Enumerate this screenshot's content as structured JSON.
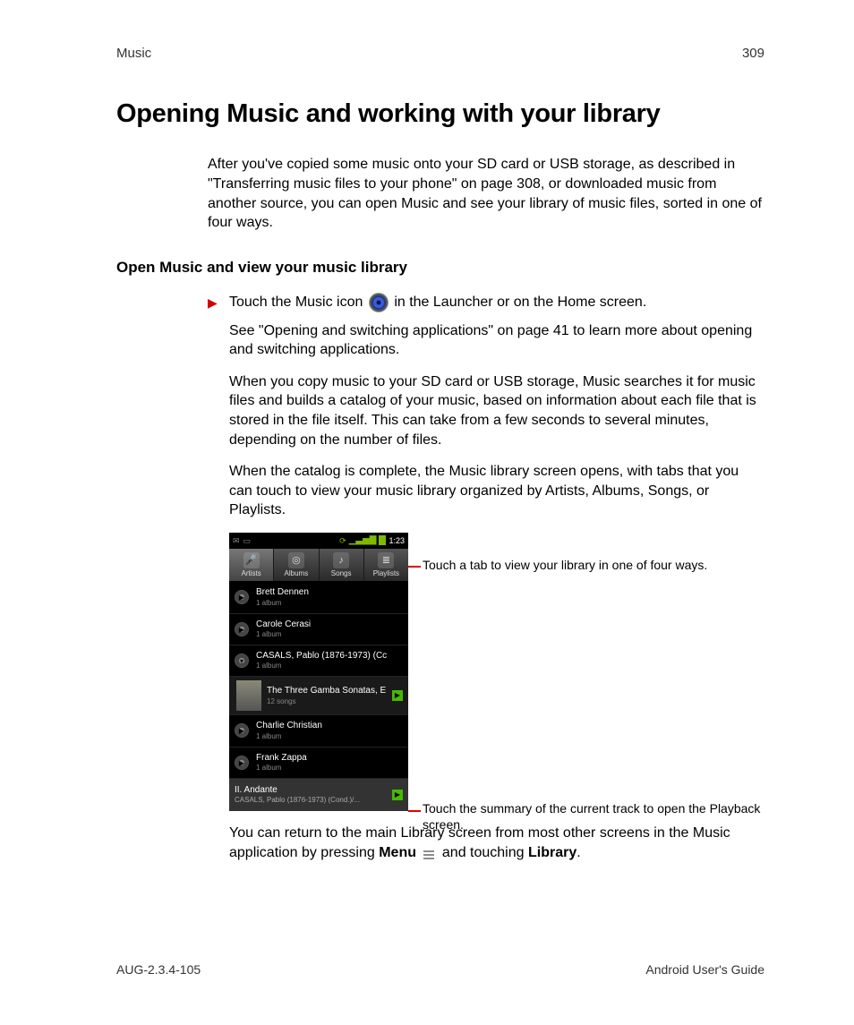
{
  "header": {
    "section": "Music",
    "page_number": "309"
  },
  "title": "Opening Music and working with your library",
  "intro": "After you've copied some music onto your SD card or USB storage, as described in \"Transferring music files to your phone\" on page 308, or downloaded music from another source, you can open Music and see your library of music files, sorted in one of four ways.",
  "subheading": "Open Music and view your music library",
  "step": {
    "pre": "Touch the Music icon ",
    "post": " in the Launcher or on the Home screen."
  },
  "paragraphs": {
    "see": "See \"Opening and switching applications\" on page 41 to learn more about opening and switching applications.",
    "copy": "When you copy music to your SD card or USB storage, Music searches it for music files and builds a catalog of your music, based on information about each file that is stored in the file itself. This can take from a few seconds to several minutes, depending on the number of files.",
    "catalog": "When the catalog is complete, the Music library screen opens, with tabs that you can touch to view your music library organized by Artists, Albums, Songs, or Playlists."
  },
  "callouts": {
    "tabs": "Touch a tab to view your library in one of four ways.",
    "nowplaying": "Touch the summary of the current track to open the Playback screen."
  },
  "after": {
    "pre": "You can return to the main Library screen from most other screens in the Music application by pressing ",
    "menu_bold": "Menu",
    "mid": " and touching ",
    "lib_bold": "Library",
    "post": "."
  },
  "phone": {
    "time": "1:23",
    "tabs": [
      "Artists",
      "Albums",
      "Songs",
      "Playlists"
    ],
    "artists": [
      {
        "name": "Brett Dennen",
        "sub": "1 album"
      },
      {
        "name": "Carole Cerasi",
        "sub": "1 album"
      },
      {
        "name": "CASALS, Pablo (1876-1973) (Cc",
        "sub": "1 album"
      },
      {
        "expanded": true,
        "name": "The Three Gamba Sonatas, E",
        "sub": "12 songs"
      },
      {
        "name": "Charlie Christian",
        "sub": "1 album"
      },
      {
        "name": "Frank Zappa",
        "sub": "1 album"
      }
    ],
    "now_playing": {
      "title": "II. Andante",
      "sub": "CASALS, Pablo (1876-1973) (Cond.)/..."
    }
  },
  "footer": {
    "left": "AUG-2.3.4-105",
    "right": "Android User's Guide"
  }
}
